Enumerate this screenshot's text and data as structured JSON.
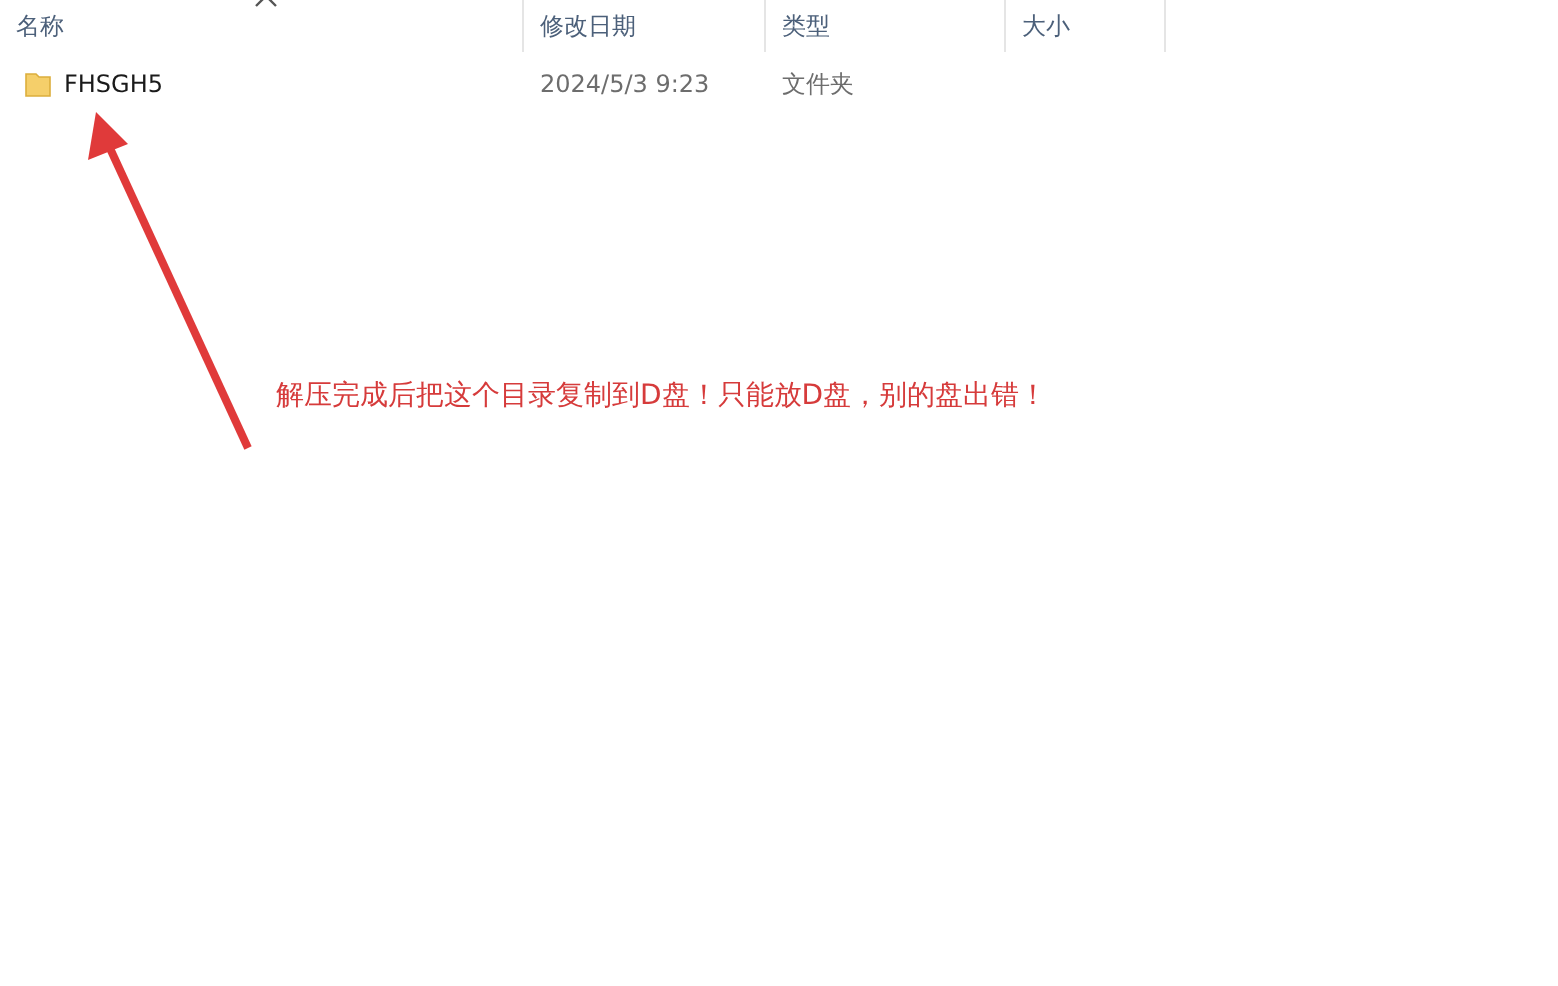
{
  "columns": [
    {
      "label": "名称"
    },
    {
      "label": "修改日期"
    },
    {
      "label": "类型"
    },
    {
      "label": "大小"
    }
  ],
  "rows": [
    {
      "name": "FHSGH5",
      "modified": "2024/5/3 9:23",
      "type": "文件夹"
    }
  ],
  "annotation": {
    "text": "解压完成后把这个目录复制到D盘！只能放D盘，别的盘出错！"
  }
}
